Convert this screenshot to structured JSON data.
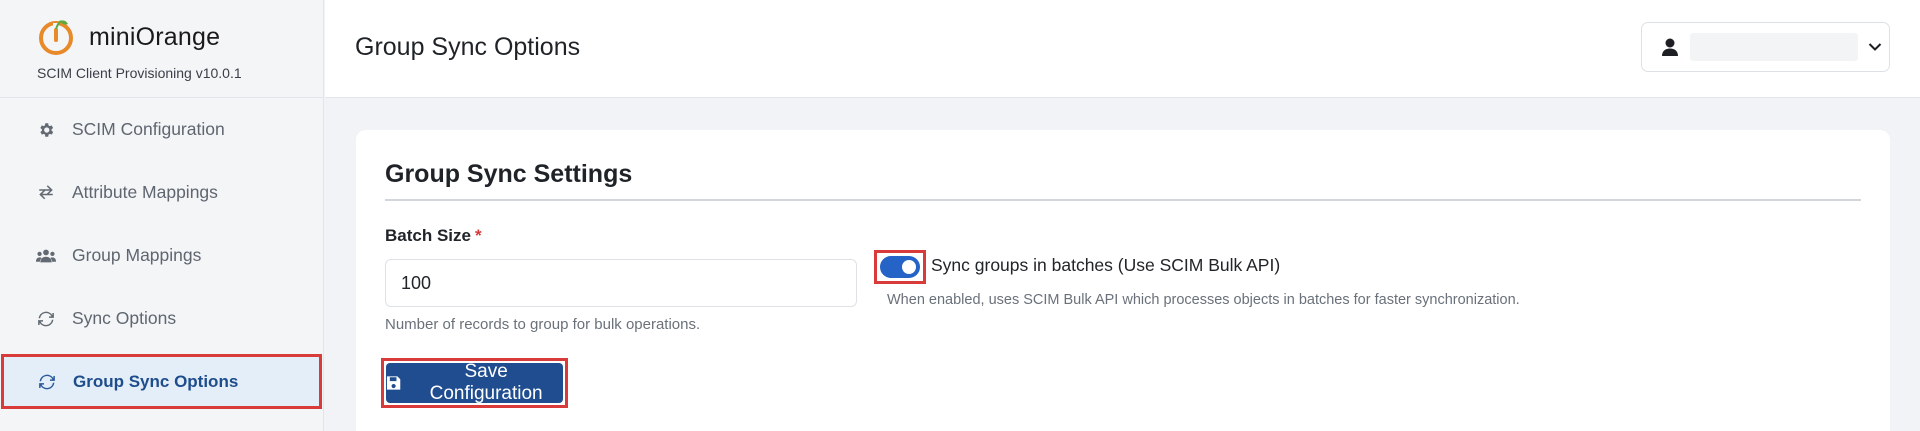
{
  "brand": {
    "name": "miniOrange",
    "subtitle": "SCIM Client Provisioning v10.0.1",
    "accent_color": "#e8892a"
  },
  "sidebar": {
    "items": [
      {
        "label": "SCIM Configuration",
        "icon": "gear-icon",
        "active": false
      },
      {
        "label": "Attribute Mappings",
        "icon": "arrows-exchange-icon",
        "active": false
      },
      {
        "label": "Group Mappings",
        "icon": "users-icon",
        "active": false
      },
      {
        "label": "Sync Options",
        "icon": "sync-icon",
        "active": false
      },
      {
        "label": "Group Sync Options",
        "icon": "sync-icon",
        "active": true
      }
    ]
  },
  "header": {
    "title": "Group Sync Options",
    "user_icon": "user-icon",
    "chevron_icon": "chevron-down-icon"
  },
  "card": {
    "title": "Group Sync Settings",
    "batch_size": {
      "label": "Batch Size",
      "required_marker": "*",
      "value": "100",
      "help": "Number of records to group for bulk operations."
    },
    "bulk_toggle": {
      "label": "Sync groups in batches (Use SCIM Bulk API)",
      "enabled": true,
      "help": "When enabled, uses SCIM Bulk API which processes objects in batches for faster synchronization."
    },
    "save_button": {
      "label": "Save Configuration",
      "icon": "save-icon",
      "color": "#1f4d8f"
    }
  },
  "highlight_color": "#d93a3a"
}
